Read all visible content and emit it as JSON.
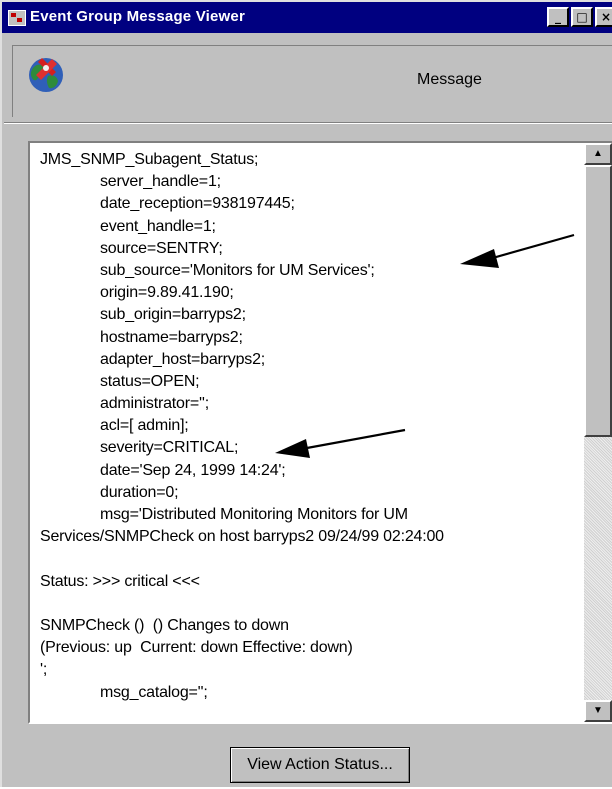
{
  "window": {
    "title": "Event Group Message Viewer",
    "title_bar_color": "#000080",
    "controls": {
      "minimize": "_",
      "maximize": "□",
      "close": "×"
    }
  },
  "header": {
    "icon": "globe-icon",
    "label": "Message"
  },
  "message": {
    "lines": [
      {
        "text": "JMS_SNMP_Subagent_Status;",
        "indent": false
      },
      {
        "text": "server_handle=1;",
        "indent": true
      },
      {
        "text": "date_reception=938197445;",
        "indent": true
      },
      {
        "text": "event_handle=1;",
        "indent": true
      },
      {
        "text": "source=SENTRY;",
        "indent": true
      },
      {
        "text": "sub_source='Monitors for UM Services';",
        "indent": true
      },
      {
        "text": "origin=9.89.41.190;",
        "indent": true
      },
      {
        "text": "sub_origin=barryps2;",
        "indent": true
      },
      {
        "text": "hostname=barryps2;",
        "indent": true
      },
      {
        "text": "adapter_host=barryps2;",
        "indent": true
      },
      {
        "text": "status=OPEN;",
        "indent": true
      },
      {
        "text": "administrator='';",
        "indent": true
      },
      {
        "text": "acl=[ admin];",
        "indent": true
      },
      {
        "text": "severity=CRITICAL;",
        "indent": true
      },
      {
        "text": "date='Sep 24, 1999 14:24';",
        "indent": true
      },
      {
        "text": "duration=0;",
        "indent": true
      },
      {
        "text": "msg='Distributed Monitoring Monitors for UM",
        "indent": true
      },
      {
        "text": "Services/SNMPCheck on host barryps2 09/24/99 02:24:00",
        "indent": false
      },
      {
        "text": "",
        "indent": false
      },
      {
        "text": "Status: >>> critical <<<",
        "indent": false
      },
      {
        "text": "",
        "indent": false
      },
      {
        "text": "SNMPCheck ()  () Changes to down",
        "indent": false
      },
      {
        "text": "(Previous: up  Current: down Effective: down)",
        "indent": false
      },
      {
        "text": "';",
        "indent": false
      },
      {
        "text": "msg_catalog='';",
        "indent": true
      }
    ]
  },
  "scrollbar": {
    "up_arrow": "▲",
    "down_arrow": "▼",
    "position": 0.0
  },
  "footer": {
    "action_button_label": "View Action Status..."
  }
}
